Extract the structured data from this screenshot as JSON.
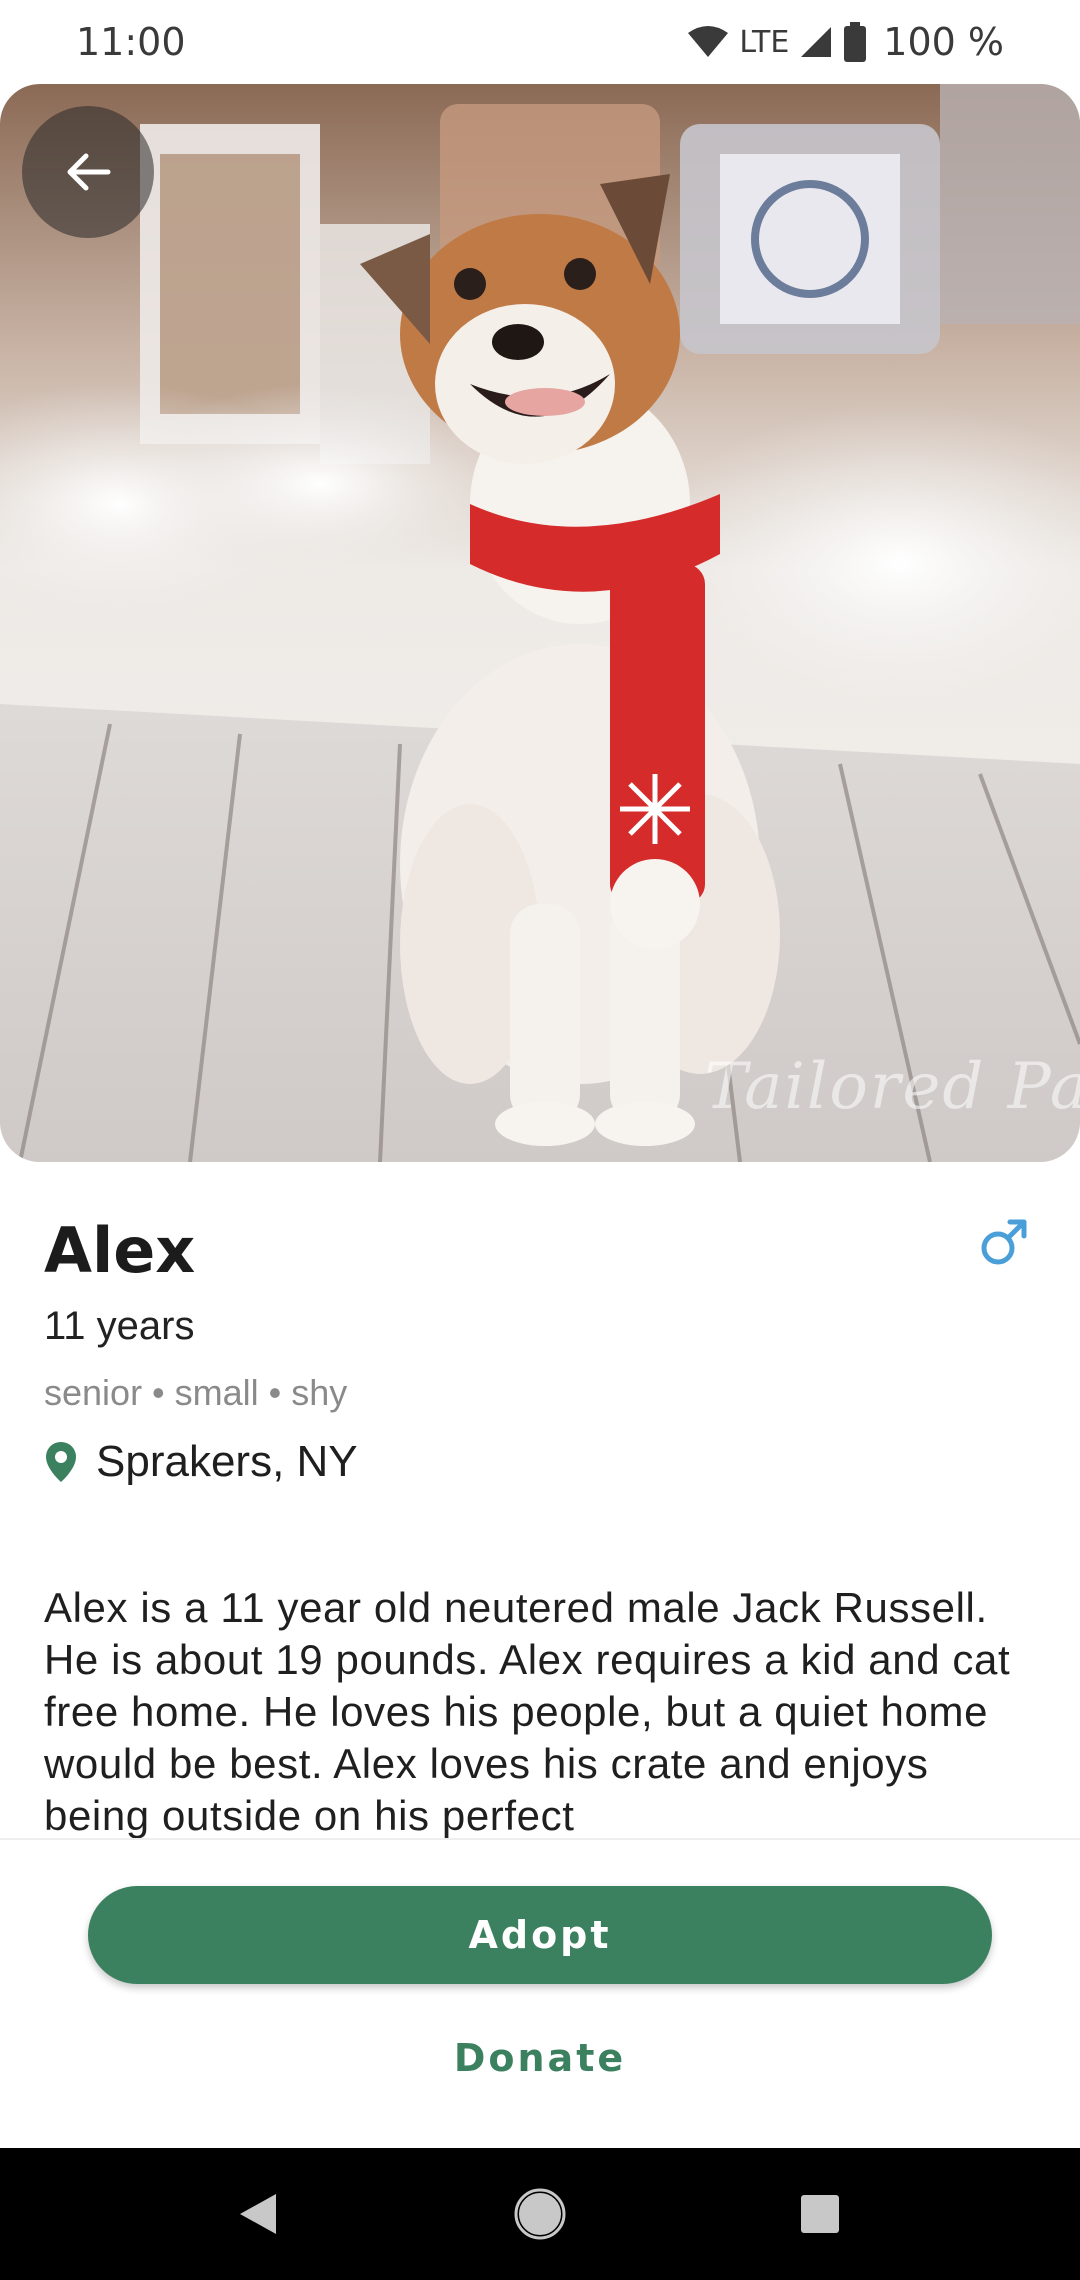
{
  "status_bar": {
    "time": "11:00",
    "network": "LTE",
    "battery": "100 %",
    "icons": [
      "wifi-icon",
      "signal-icon",
      "battery-icon"
    ]
  },
  "hero": {
    "watermark": "Tailored Pa",
    "back_icon": "arrow-back-icon"
  },
  "pet": {
    "name": "Alex",
    "age": "11 years",
    "tags": "senior • small • shy",
    "location": "Sprakers, NY",
    "gender_icon": "male-icon",
    "description": "Alex is a 11 year old neutered male Jack Russell. He is about 19 pounds. Alex requires a kid and cat free home. He loves his people, but a quiet home would be best. Alex loves his crate and enjoys being outside on his perfect"
  },
  "actions": {
    "adopt_label": "Adopt",
    "donate_label": "Donate"
  },
  "colors": {
    "accent": "#3b8160",
    "gender": "#4a9fd8",
    "location_pin": "#3b8160"
  },
  "nav": {
    "icons": [
      "nav-back-icon",
      "nav-home-icon",
      "nav-recents-icon"
    ]
  }
}
